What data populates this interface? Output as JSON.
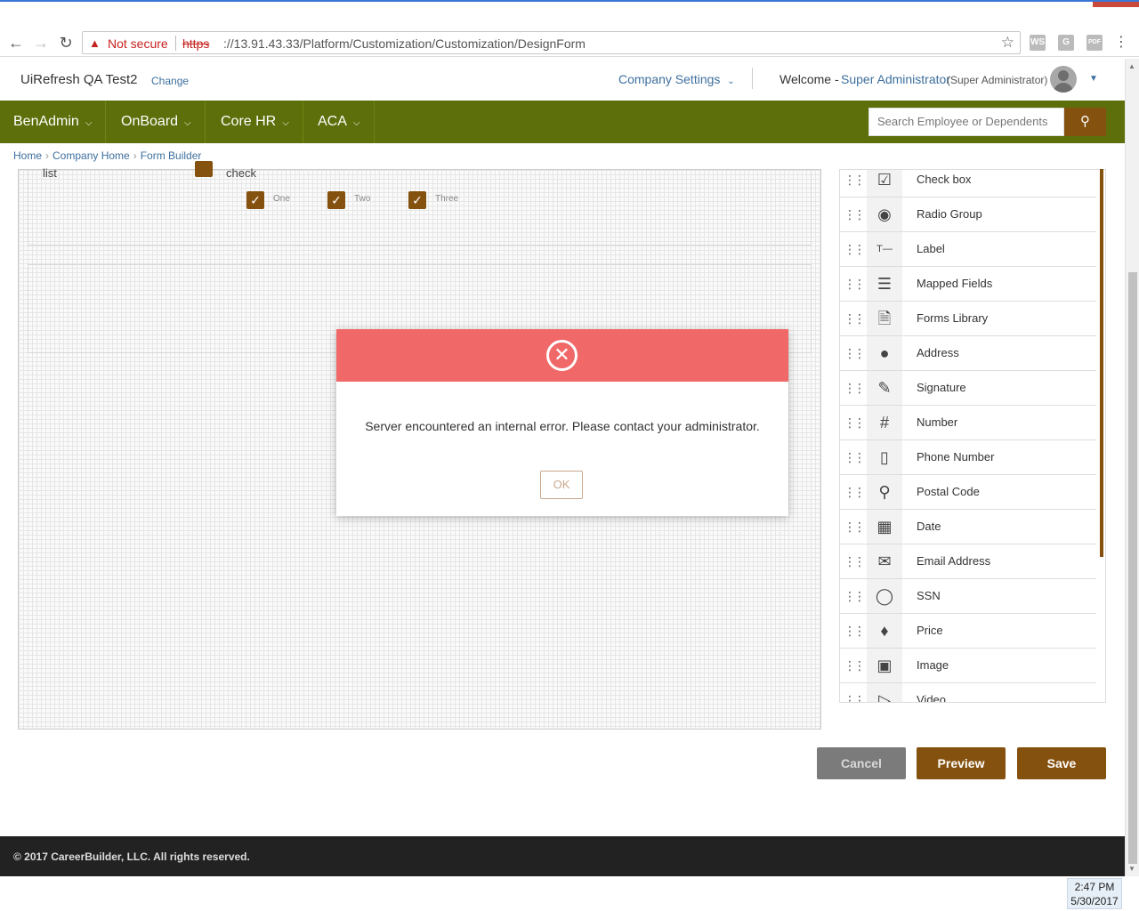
{
  "browser": {
    "security_label": "Not secure",
    "url_scheme": "https",
    "url_rest": "://13.91.43.33/Platform/Customization/Customization/DesignForm",
    "extensions": [
      "WS",
      "G",
      "PDF"
    ]
  },
  "header": {
    "company_name": "UiRefresh QA Test2",
    "change_label": "Change",
    "company_settings_label": "Company Settings",
    "welcome_label": "Welcome -",
    "user_name": "Super Administrator",
    "user_role": "(Super Administrator)"
  },
  "nav": {
    "items": [
      {
        "label": "BenAdmin"
      },
      {
        "label": "OnBoard"
      },
      {
        "label": "Core HR"
      },
      {
        "label": "ACA"
      }
    ],
    "search_placeholder": "Search Employee or Dependents"
  },
  "breadcrumb": {
    "items": [
      "Home",
      "Company Home",
      "Form Builder"
    ]
  },
  "canvas": {
    "list_label": "list",
    "check_label": "check",
    "options": [
      "One",
      "Two",
      "Three"
    ]
  },
  "controls": {
    "items": [
      {
        "label": "Check box",
        "icon": "checkbox-icon"
      },
      {
        "label": "Radio Group",
        "icon": "radio-icon"
      },
      {
        "label": "Label",
        "icon": "label-text-icon"
      },
      {
        "label": "Mapped Fields",
        "icon": "mapped-fields-icon"
      },
      {
        "label": "Forms Library",
        "icon": "forms-library-icon"
      },
      {
        "label": "Address",
        "icon": "map-pin-icon"
      },
      {
        "label": "Signature",
        "icon": "signature-icon"
      },
      {
        "label": "Number",
        "icon": "hash-icon"
      },
      {
        "label": "Phone Number",
        "icon": "phone-icon"
      },
      {
        "label": "Postal Code",
        "icon": "postal-pin-icon"
      },
      {
        "label": "Date",
        "icon": "calendar-icon"
      },
      {
        "label": "Email Address",
        "icon": "envelope-icon"
      },
      {
        "label": "SSN",
        "icon": "person-icon"
      },
      {
        "label": "Price",
        "icon": "price-tag-icon"
      },
      {
        "label": "Image",
        "icon": "image-icon"
      },
      {
        "label": "Video",
        "icon": "video-icon"
      }
    ]
  },
  "actions": {
    "cancel_label": "Cancel",
    "preview_label": "Preview",
    "save_label": "Save"
  },
  "footer": {
    "copyright": "© 2017 CareerBuilder, LLC. All rights reserved."
  },
  "taskbar": {
    "time": "2:47 PM",
    "date": "5/30/2017"
  },
  "modal": {
    "message": "Server encountered an internal error. Please contact your administrator.",
    "ok_label": "OK"
  },
  "colors": {
    "nav_bg": "#5c6f0a",
    "brand_brown": "#85510f",
    "error_red": "#f06868",
    "link_blue": "#3d6f9e"
  }
}
